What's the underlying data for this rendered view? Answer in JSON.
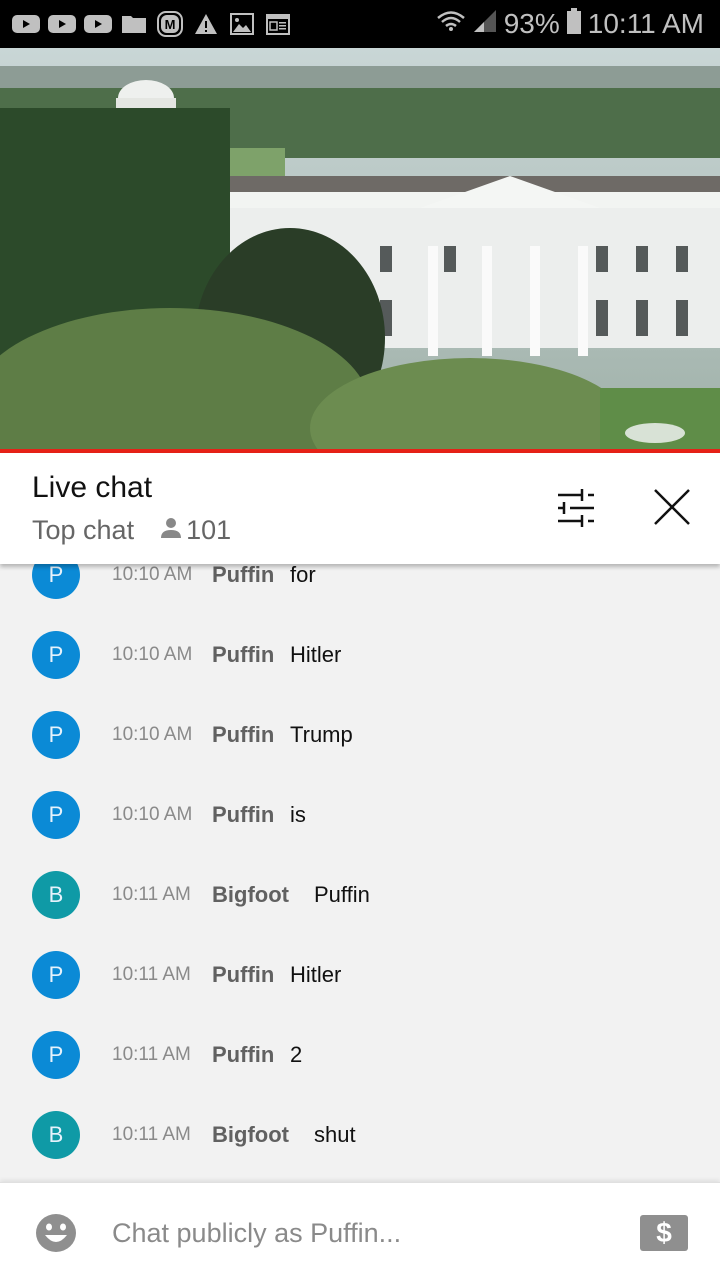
{
  "status_bar": {
    "notification_icons": [
      "youtube-icon",
      "youtube-icon",
      "youtube-icon",
      "folder-icon",
      "m-app-icon",
      "warning-icon",
      "image-icon",
      "calendar-icon"
    ],
    "battery": "93%",
    "time": "10:11 AM"
  },
  "video": {
    "description": "Live stream of the White House north facade"
  },
  "chat_header": {
    "title": "Live chat",
    "mode": "Top chat",
    "viewer_count": "101"
  },
  "messages": [
    {
      "avatar": "P",
      "avatar_color": "#0b8ad6",
      "time": "10:10 AM",
      "author": "Puffin",
      "text": "for"
    },
    {
      "avatar": "P",
      "avatar_color": "#0b8ad6",
      "time": "10:10 AM",
      "author": "Puffin",
      "text": "Hitler"
    },
    {
      "avatar": "P",
      "avatar_color": "#0b8ad6",
      "time": "10:10 AM",
      "author": "Puffin",
      "text": "Trump"
    },
    {
      "avatar": "P",
      "avatar_color": "#0b8ad6",
      "time": "10:10 AM",
      "author": "Puffin",
      "text": "is"
    },
    {
      "avatar": "B",
      "avatar_color": "#0f9aa6",
      "time": "10:11 AM",
      "author": "Bigfoot",
      "text": "Puffin"
    },
    {
      "avatar": "P",
      "avatar_color": "#0b8ad6",
      "time": "10:11 AM",
      "author": "Puffin",
      "text": "Hitler"
    },
    {
      "avatar": "P",
      "avatar_color": "#0b8ad6",
      "time": "10:11 AM",
      "author": "Puffin",
      "text": "2"
    },
    {
      "avatar": "B",
      "avatar_color": "#0f9aa6",
      "time": "10:11 AM",
      "author": "Bigfoot",
      "text": "shut"
    }
  ],
  "input": {
    "placeholder": "Chat publicly as Puffin...",
    "value": "",
    "superchat_symbol": "$"
  },
  "colors": {
    "accent_red": "#e62117"
  }
}
